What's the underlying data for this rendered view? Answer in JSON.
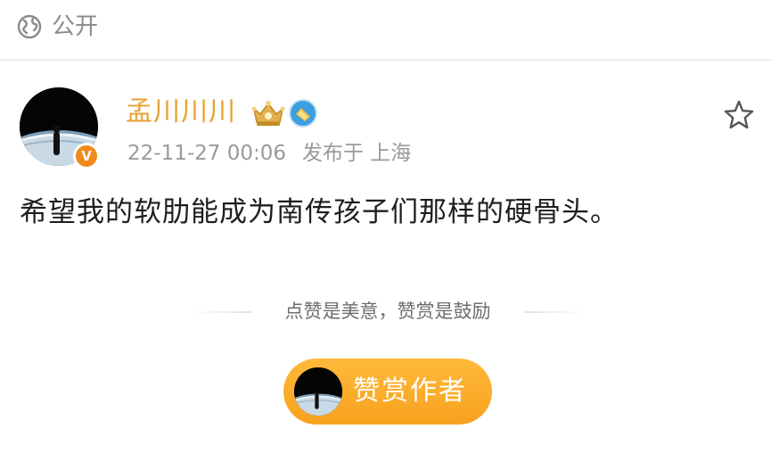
{
  "visibility": {
    "icon": "globe-icon",
    "label": "公开"
  },
  "author": {
    "name": "孟川川川",
    "verify_badge": "V",
    "badge_icons": [
      "crown-membership-icon",
      "member-level-icon"
    ]
  },
  "post": {
    "date": "22-11-27 00:06",
    "location": "发布于 上海",
    "text": "希望我的软肋能成为南传孩子们那样的硬骨头。"
  },
  "reward": {
    "hint": "点赞是美意，赞赏是鼓励",
    "button_label": "赞赏作者"
  },
  "actions": {
    "favorite_icon": "star-outline-icon"
  },
  "colors": {
    "author_name": "#e8a236",
    "reward_button": "#f7a21f",
    "verify_badge": "#f08a1c",
    "meta_text": "#9a9a9a"
  }
}
